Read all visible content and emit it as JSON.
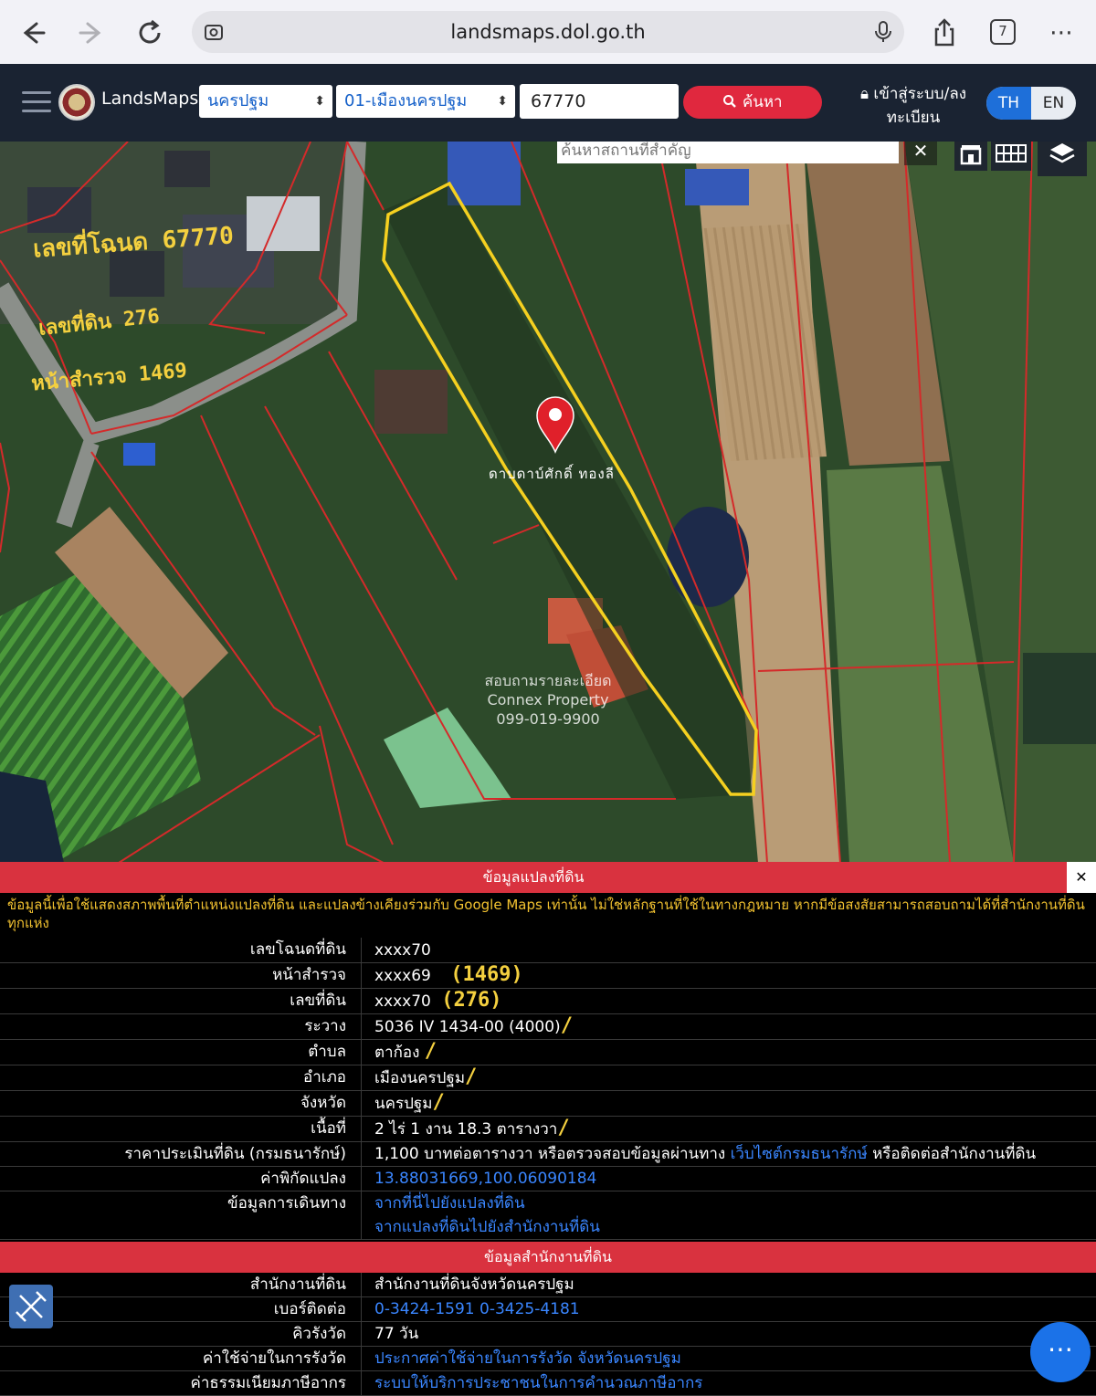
{
  "browser": {
    "url": "landsmaps.dol.go.th",
    "tab_count": "7"
  },
  "header": {
    "brand": "LandsMaps",
    "province_select": "นครปฐม",
    "district_select": "01-เมืองนครปฐม",
    "parcel_input": "67770",
    "search_label": "ค้นหา",
    "login_label": "เข้าสู่ระบบ/ลงทะเบียน",
    "lang_th": "TH",
    "lang_en": "EN"
  },
  "map": {
    "place_search_placeholder": "ค้นหาสถานที่สำคัญ",
    "handwritten_deed": "เลขที่โฉนด 67770",
    "handwritten_land_no": "เลขที่ดิน 276",
    "handwritten_survey": "หน้าสำรวจ 1469",
    "marker_label": "ดาบดาบ์ศักดิ์ ทองลี",
    "watermark_line1": "สอบถามรายละเอียด",
    "watermark_line2": "Connex Property",
    "watermark_line3": "099-019-9900"
  },
  "parcel_info": {
    "title": "ข้อมูลแปลงที่ดิน",
    "disclaimer": "ข้อมูลนี้เพื่อใช้แสดงสภาพพื้นที่ตำแหน่งแปลงที่ดิน และแปลงข้างเคียงร่วมกับ Google Maps เท่านั้น ไม่ใช่หลักฐานที่ใช้ในทางกฎหมาย หากมีข้อสงสัยสามารถสอบถามได้ที่สำนักงานที่ดินทุกแห่ง",
    "rows": [
      {
        "label": "เลขโฉนดที่ดิน",
        "value": "xxxx70",
        "note": ""
      },
      {
        "label": "หน้าสำรวจ",
        "value": "xxxx69",
        "note": "(1469)"
      },
      {
        "label": "เลขที่ดิน",
        "value": "xxxx70",
        "note": "(276)"
      },
      {
        "label": "ระวาง",
        "value": "5036 IV 1434-00 (4000)",
        "note": "/"
      },
      {
        "label": "ตำบล",
        "value": "ตาก้อง",
        "note": "/"
      },
      {
        "label": "อำเภอ",
        "value": "เมืองนครปฐม",
        "note": "/"
      },
      {
        "label": "จังหวัด",
        "value": "นครปฐม",
        "note": "/"
      },
      {
        "label": "เนื้อที่",
        "value": "2 ไร่ 1 งาน 18.3 ตารางวา",
        "note": "/"
      }
    ],
    "price_label": "ราคาประเมินที่ดิน (กรมธนารักษ์)",
    "price_value": "1,100 บาทต่อตารางวา หรือตรวจสอบข้อมูลผ่านทาง",
    "price_link": "เว็บไซต์กรมธนารักษ์",
    "price_suffix": "หรือติดต่อสำนักงานที่ดิน",
    "coord_label": "ค่าพิกัดแปลง",
    "coord_value": "13.88031669,100.06090184",
    "route_label": "ข้อมูลการเดินทาง",
    "route_link1": "จากที่นี่ไปยังแปลงที่ดิน",
    "route_link2": "จากแปลงที่ดินไปยังสำนักงานที่ดิน"
  },
  "office_info": {
    "title": "ข้อมูลสำนักงานที่ดิน",
    "office_label": "สำนักงานที่ดิน",
    "office_value": "สำนักงานที่ดินจังหวัดนครปฐม",
    "phone_label": "เบอร์ติดต่อ",
    "phone_value": "0-3424-1591 0-3425-4181",
    "queue_label": "คิวรังวัด",
    "queue_value": "77 วัน",
    "survey_cost_label": "ค่าใช้จ่ายในการรังวัด",
    "survey_cost_link": "ประกาศค่าใช้จ่ายในการรังวัด จังหวัดนครปฐม",
    "tax_label": "ค่าธรรมเนียมภาษีอากร",
    "tax_link": "ระบบให้บริการประชาชนในการคำนวณภาษีอากร"
  },
  "colors": {
    "header_bg": "#1a2332",
    "accent_red": "#d9323f",
    "link_blue": "#3a86ff",
    "disclaimer_yellow": "#f2c230",
    "parcel_outline": "#f5d020"
  }
}
